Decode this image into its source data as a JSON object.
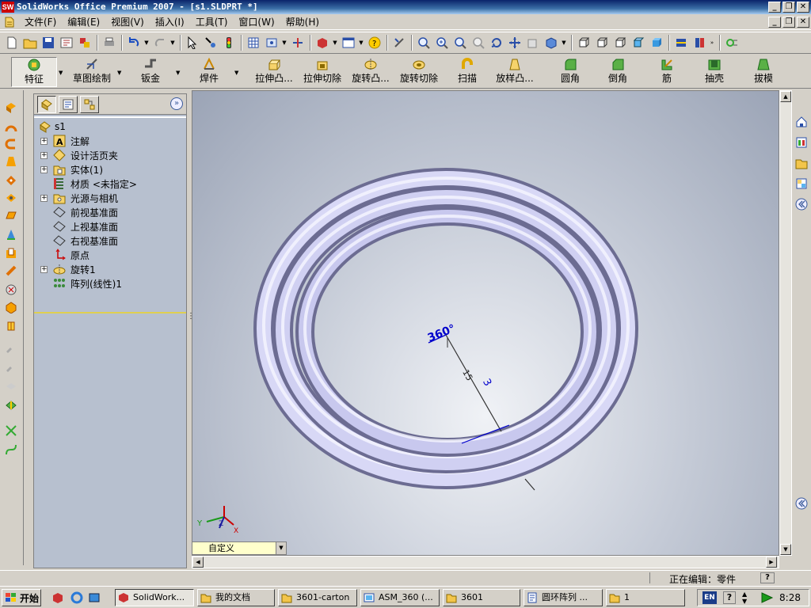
{
  "window": {
    "title": "SolidWorks Office Premium 2007 - [s1.SLDPRT *]",
    "logo_text": "SW",
    "minimize": "_",
    "restore": "❐",
    "close": "✕"
  },
  "menu": {
    "items": [
      "文件(F)",
      "编辑(E)",
      "视图(V)",
      "插入(I)",
      "工具(T)",
      "窗口(W)",
      "帮助(H)"
    ]
  },
  "features_toolbar": {
    "buttons": [
      {
        "label": "特征",
        "icon": "features-icon"
      },
      {
        "label": "草图绘制",
        "icon": "sketch-icon"
      },
      {
        "label": "钣金",
        "icon": "sheet-metal-icon"
      },
      {
        "label": "焊件",
        "icon": "weldments-icon"
      },
      {
        "label": "拉伸凸...",
        "icon": "extruded-boss-icon"
      },
      {
        "label": "拉伸切除",
        "icon": "extruded-cut-icon"
      },
      {
        "label": "旋转凸...",
        "icon": "revolved-boss-icon"
      },
      {
        "label": "旋转切除",
        "icon": "revolved-cut-icon"
      },
      {
        "label": "扫描",
        "icon": "sweep-icon"
      },
      {
        "label": "放样凸...",
        "icon": "loft-icon"
      },
      {
        "label": "圆角",
        "icon": "fillet-icon"
      },
      {
        "label": "倒角",
        "icon": "chamfer-icon"
      },
      {
        "label": "筋",
        "icon": "rib-icon"
      },
      {
        "label": "抽壳",
        "icon": "shell-icon"
      },
      {
        "label": "拔模",
        "icon": "draft-icon"
      }
    ]
  },
  "feature_manager": {
    "root": "s1",
    "items": [
      {
        "label": "注解",
        "expandable": true,
        "icon": "annotations-icon"
      },
      {
        "label": "设计活页夹",
        "expandable": true,
        "icon": "design-binder-icon"
      },
      {
        "label": "实体(1)",
        "expandable": true,
        "icon": "solid-bodies-icon"
      },
      {
        "label": "材质 <未指定>",
        "expandable": false,
        "icon": "material-icon"
      },
      {
        "label": "光源与相机",
        "expandable": true,
        "icon": "lights-cameras-icon"
      },
      {
        "label": "前视基准面",
        "expandable": false,
        "icon": "plane-icon"
      },
      {
        "label": "上视基准面",
        "expandable": false,
        "icon": "plane-icon"
      },
      {
        "label": "右视基准面",
        "expandable": false,
        "icon": "plane-icon"
      },
      {
        "label": "原点",
        "expandable": false,
        "icon": "origin-icon"
      },
      {
        "label": "旋转1",
        "expandable": true,
        "icon": "revolve-feature-icon"
      },
      {
        "label": "阵列(线性)1",
        "expandable": false,
        "icon": "linear-pattern-icon"
      }
    ]
  },
  "viewport": {
    "dimensions": {
      "angle": "360°",
      "radius": "15",
      "distance": "3"
    },
    "triad": {
      "x": "X",
      "y": "Y",
      "z": "Z"
    },
    "view_selector": "自定义"
  },
  "status": {
    "text": "正在编辑：零件",
    "help": "?"
  },
  "taskbar": {
    "start": "开始",
    "tasks": [
      {
        "label": "SolidWork...",
        "active": true
      },
      {
        "label": "我的文档",
        "active": false
      },
      {
        "label": "3601-carton",
        "active": false
      },
      {
        "label": "ASM_360 (...",
        "active": false
      },
      {
        "label": "3601",
        "active": false
      },
      {
        "label": "圆环阵列 ...",
        "active": false
      },
      {
        "label": "1",
        "active": false
      }
    ],
    "tray": {
      "ime": "EN",
      "help": "?",
      "clock": "8:28"
    }
  },
  "colors": {
    "title_bar": "#0a246a",
    "dimension": "#0000cc",
    "rollback_bar": "#dfcf50",
    "tree_bg": "#b7c0cf",
    "ring": "#b6b6e8"
  }
}
